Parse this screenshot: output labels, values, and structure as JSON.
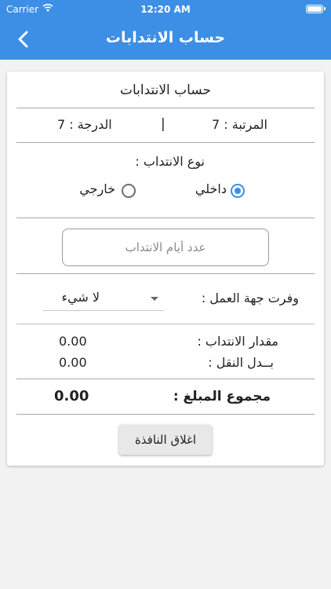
{
  "status_bar": {
    "carrier": "Carrier",
    "time": "12:20 AM"
  },
  "app_bar": {
    "title": "حساب الانتدابات",
    "back_icon": "chevron-left-icon"
  },
  "form": {
    "heading": "حساب الانتدابات",
    "rank": "المرتبة : 7",
    "separator": "|",
    "grade": "الدرجة : 7",
    "assignment_type_label": "نوع الانتداب :",
    "internal_label": "داخلي",
    "external_label": "خارجي",
    "selected_type": "internal",
    "days_placeholder": "عدد أيام الانتداب",
    "days_value": "",
    "provided_label": "وفرت جهة العمل   :",
    "provided_value": "لا شيء",
    "amount_label": "مقدار الانتداب  :",
    "amount_value": "0.00",
    "transport_label": "بــدل النقل   :",
    "transport_value": "0.00",
    "total_label": "مجموع المبلغ  :",
    "total_value": "0.00",
    "close_label": "اغلاق النافذة"
  },
  "colors": {
    "accent": "#3d8fe6",
    "background": "#f2f2f2"
  }
}
